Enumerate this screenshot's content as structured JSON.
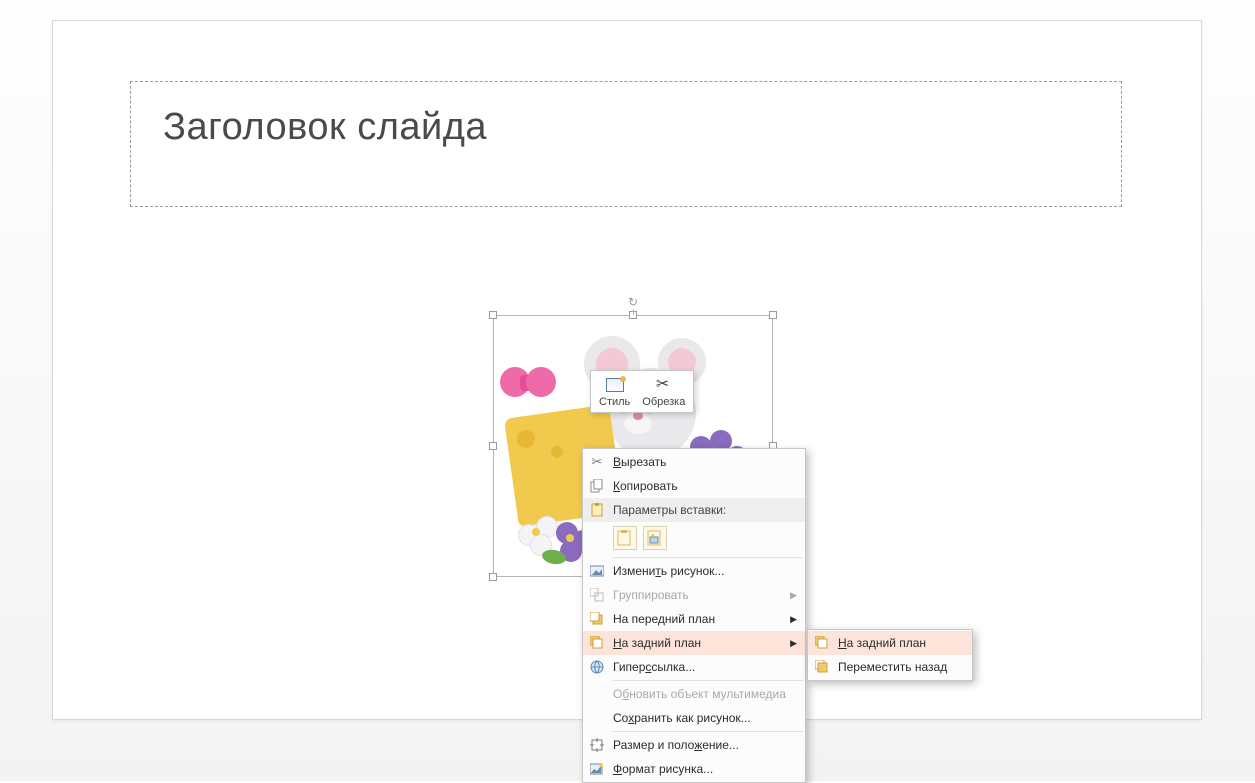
{
  "slide": {
    "title_placeholder": "Заголовок слайда"
  },
  "mini_toolbar": {
    "style": "Стиль",
    "crop": "Обрезка"
  },
  "context_menu": {
    "cut": "Вырезать",
    "copy": "Копировать",
    "paste_options_header": "Параметры вставки:",
    "change_picture": "Изменить рисунок...",
    "group": "Группировать",
    "bring_to_front": "На передний план",
    "send_to_back": "На задний план",
    "hyperlink": "Гиперссылка...",
    "update_media": "Обновить объект мультимедиа",
    "save_as_picture": "Сохранить как рисунок...",
    "size_position": "Размер и положение...",
    "format_picture": "Формат рисунка..."
  },
  "submenu": {
    "send_to_back": "На задний план",
    "send_backward": "Переместить назад"
  }
}
